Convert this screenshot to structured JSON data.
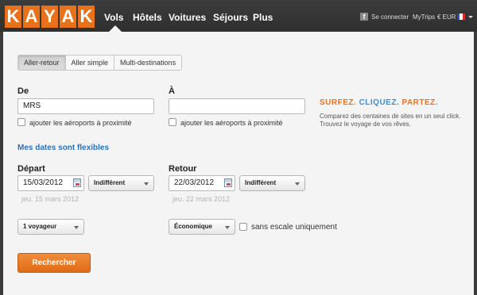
{
  "brand": {
    "letters": [
      "K",
      "A",
      "Y",
      "A",
      "K"
    ]
  },
  "nav": {
    "items": [
      {
        "label": "Vols"
      },
      {
        "label": "Hôtels"
      },
      {
        "label": "Voitures"
      },
      {
        "label": "Séjours"
      },
      {
        "label": "Plus"
      }
    ],
    "active": "Vols",
    "signin_label": "Se connecter",
    "mytrips_label": "MyTrips",
    "currency_label": "€ EUR"
  },
  "tabs": [
    {
      "label": "Aller-retour",
      "active": true
    },
    {
      "label": "Aller simple",
      "active": false
    },
    {
      "label": "Multi-destinations",
      "active": false
    }
  ],
  "form": {
    "from_label": "De",
    "from_value": "MRS",
    "to_label": "À",
    "to_value": "",
    "nearby_label": "ajouter les aéroports à proximité",
    "flexible_link": "Mes dates sont flexibles",
    "depart_label": "Départ",
    "depart_value": "15/03/2012",
    "depart_hint": "jeu. 15 mars 2012",
    "depart_time": "Indifférent",
    "return_label": "Retour",
    "return_value": "22/03/2012",
    "return_hint": "jeu. 22 mars 2012",
    "return_time": "Indifférent",
    "travelers": "1 voyageur",
    "cabin": "Économique",
    "nonstop_label": "sans escale uniquement",
    "search_label": "Rechercher"
  },
  "promo": {
    "word1": "SURFEZ.",
    "word2": "CLIQUEZ.",
    "word3": "PARTEZ.",
    "color1": "#e8721c",
    "color2": "#3a8fd6",
    "color3": "#e8721c",
    "line1": "Comparez des centaines de sites en un seul click.",
    "line2": "Trouvez le voyage de vos rêves."
  },
  "colors": {
    "accent": "#e8721c",
    "link": "#2f6fb4",
    "topbar": "#333333"
  }
}
